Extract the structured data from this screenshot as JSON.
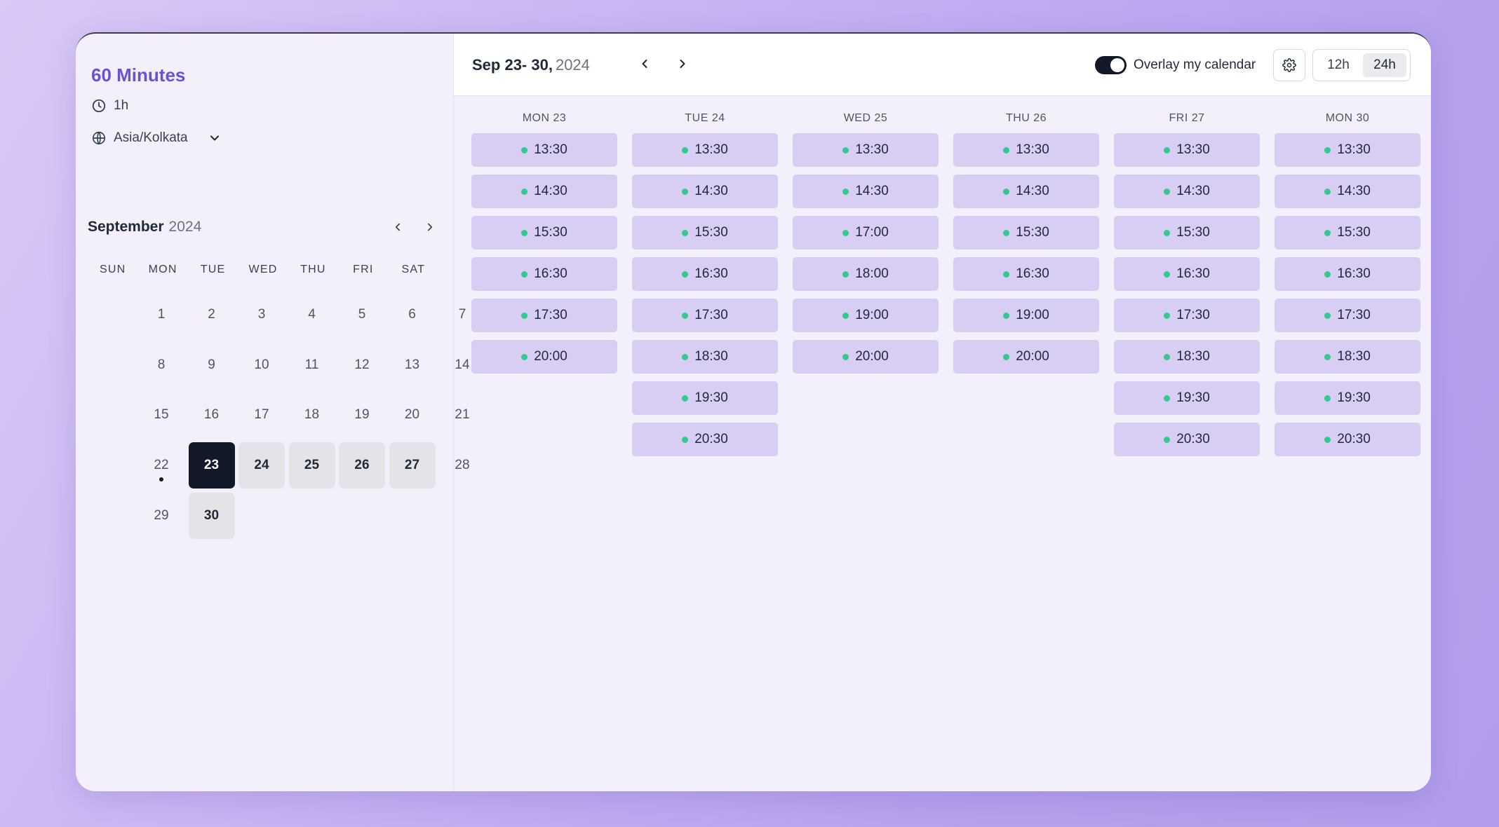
{
  "event": {
    "title": "60 Minutes",
    "duration": "1h",
    "timezone": "Asia/Kolkata"
  },
  "month": {
    "name": "September",
    "year": "2024",
    "weekdays": [
      "SUN",
      "MON",
      "TUE",
      "WED",
      "THU",
      "FRI",
      "SAT"
    ],
    "days": [
      {
        "label": "1",
        "state": "normal"
      },
      {
        "label": "2",
        "state": "normal"
      },
      {
        "label": "3",
        "state": "normal"
      },
      {
        "label": "4",
        "state": "normal"
      },
      {
        "label": "5",
        "state": "normal"
      },
      {
        "label": "6",
        "state": "normal"
      },
      {
        "label": "7",
        "state": "normal"
      },
      {
        "label": "8",
        "state": "normal"
      },
      {
        "label": "9",
        "state": "normal"
      },
      {
        "label": "10",
        "state": "normal"
      },
      {
        "label": "11",
        "state": "normal"
      },
      {
        "label": "12",
        "state": "normal"
      },
      {
        "label": "13",
        "state": "normal"
      },
      {
        "label": "14",
        "state": "normal"
      },
      {
        "label": "15",
        "state": "normal"
      },
      {
        "label": "16",
        "state": "normal"
      },
      {
        "label": "17",
        "state": "normal"
      },
      {
        "label": "18",
        "state": "normal"
      },
      {
        "label": "19",
        "state": "normal"
      },
      {
        "label": "20",
        "state": "normal"
      },
      {
        "label": "21",
        "state": "normal"
      },
      {
        "label": "22",
        "state": "today"
      },
      {
        "label": "23",
        "state": "selected"
      },
      {
        "label": "24",
        "state": "available"
      },
      {
        "label": "25",
        "state": "available"
      },
      {
        "label": "26",
        "state": "available"
      },
      {
        "label": "27",
        "state": "available"
      },
      {
        "label": "28",
        "state": "normal"
      },
      {
        "label": "29",
        "state": "normal"
      },
      {
        "label": "30",
        "state": "available"
      }
    ]
  },
  "week": {
    "range_main": "Sep 23- 30,",
    "range_year": "2024",
    "overlay_label": "Overlay my calendar",
    "overlay_on": true,
    "format_options": [
      "12h",
      "24h"
    ],
    "format_active": "24h",
    "columns": [
      {
        "day": "MON 23",
        "slots": [
          "13:30",
          "14:30",
          "15:30",
          "16:30",
          "17:30",
          "20:00"
        ]
      },
      {
        "day": "TUE 24",
        "slots": [
          "13:30",
          "14:30",
          "15:30",
          "16:30",
          "17:30",
          "18:30",
          "19:30",
          "20:30"
        ]
      },
      {
        "day": "WED 25",
        "slots": [
          "13:30",
          "14:30",
          "17:00",
          "18:00",
          "19:00",
          "20:00"
        ]
      },
      {
        "day": "THU 26",
        "slots": [
          "13:30",
          "14:30",
          "15:30",
          "16:30",
          "19:00",
          "20:00"
        ]
      },
      {
        "day": "FRI 27",
        "slots": [
          "13:30",
          "14:30",
          "15:30",
          "16:30",
          "17:30",
          "18:30",
          "19:30",
          "20:30"
        ]
      },
      {
        "day": "MON 30",
        "slots": [
          "13:30",
          "14:30",
          "15:30",
          "16:30",
          "17:30",
          "18:30",
          "19:30",
          "20:30"
        ]
      }
    ]
  },
  "colors": {
    "accent": "#6d4fd1",
    "slot_bg": "#d8cef4",
    "available_dot": "#34c98e",
    "selected_day": "#111827"
  },
  "icons": {
    "duration": "clock-icon",
    "timezone": "globe-icon",
    "timezone_dropdown": "chevron-down-icon",
    "prev": "chevron-left-icon",
    "next": "chevron-right-icon",
    "settings": "gear-icon"
  }
}
